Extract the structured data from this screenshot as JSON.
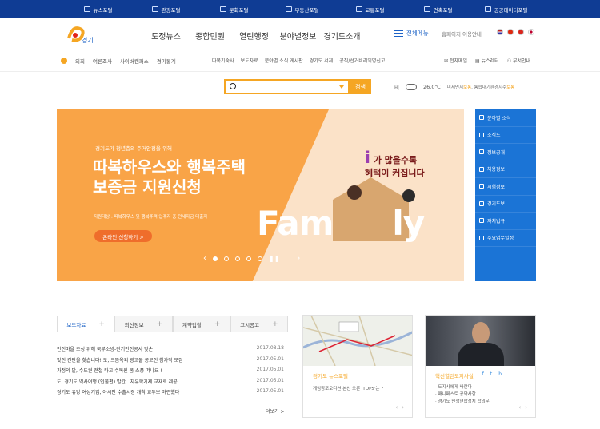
{
  "topbar": [
    "뉴스포털",
    "관광포털",
    "문화포털",
    "부동산포털",
    "교통포털",
    "건축포털",
    "공공데이터포털"
  ],
  "header": {
    "logo_alt": "경기도",
    "gnb": [
      "도정뉴스",
      "종합민원",
      "열린행정",
      "분야별정보",
      "경기도소개"
    ],
    "all_menu": "전체메뉴",
    "search_hint": "홈페이지 이용안내"
  },
  "util": {
    "left": [
      "의회",
      "여론조사",
      "사이버캠퍼스",
      "경기통계"
    ],
    "mid": [
      "따복기숙사",
      "보도자료",
      "분야별 소식 게시판",
      "경기도 서체",
      "공직/선거비리익명신고"
    ],
    "right": [
      "전자메일",
      "뉴스레터",
      "부서안내"
    ]
  },
  "search": {
    "button": "검색",
    "placeholder": ""
  },
  "weather": {
    "condition": "비",
    "temp": "26.0℃",
    "air_prefix": "미세먼지",
    "air_value": "보통",
    "air_mid": ", 통합대기환경지수",
    "air_value2": "보통"
  },
  "banner": {
    "sub": "경기도가 청년층의 주거안정을 위해",
    "title1": "따복하우스와 행복주택",
    "title2": "보증금 지원신청",
    "desc": "지원대상 : 따복하우스 및 행복주택 입주자 중 전세자금 대출자",
    "cta": "온라인 신청하기 >",
    "right1": "가 많을수록",
    "right_i": "i",
    "right2": "혜택이 커집니다",
    "fam": "Fam",
    "ly": "ly"
  },
  "side_menu": [
    "분야별 소식",
    "조직도",
    "정보공개",
    "채용정보",
    "시험정보",
    "경기도보",
    "자치법규",
    "주요업무일정"
  ],
  "tabs": [
    "보도자료",
    "최신정보",
    "계약입찰",
    "고시공고"
  ],
  "news": [
    {
      "title": "안전마을 조성 위해 북부소방-전기안전공사 맞손",
      "date": "2017.08.18"
    },
    {
      "title": "멋진 간판을 찾습니다! 도, 으뜸옥외 광고물 공모전 참가작 모집",
      "date": "2017.05.01"
    },
    {
      "title": "가정의 달, 수도권 전철 타고 수목원 봄 소풍 떠나요 !",
      "date": "2017.05.01"
    },
    {
      "title": "도, 경기도 역사여행 (인물편) 발간...자유학기제 교재로 제공",
      "date": "2017.05.01"
    },
    {
      "title": "경기도 유망 여성기업, 아시안 수출시장 개척 교두보 마련했다",
      "date": "2017.05.01"
    }
  ],
  "more": "더보기 >",
  "card1": {
    "title": "경기도 뉴스포털",
    "text": "게임창조오디션 본선 오른 'TOP5'는 ?"
  },
  "card2": {
    "title": "혁신열린도지사실",
    "items": [
      "· 도지사에게 바란다",
      "· 매니페스토 공약사항",
      "· 경기도 민생연합정치 합의문"
    ]
  },
  "colors": {
    "navy": "#0f3c94",
    "orange": "#f5a623",
    "blue": "#1b74d6"
  }
}
